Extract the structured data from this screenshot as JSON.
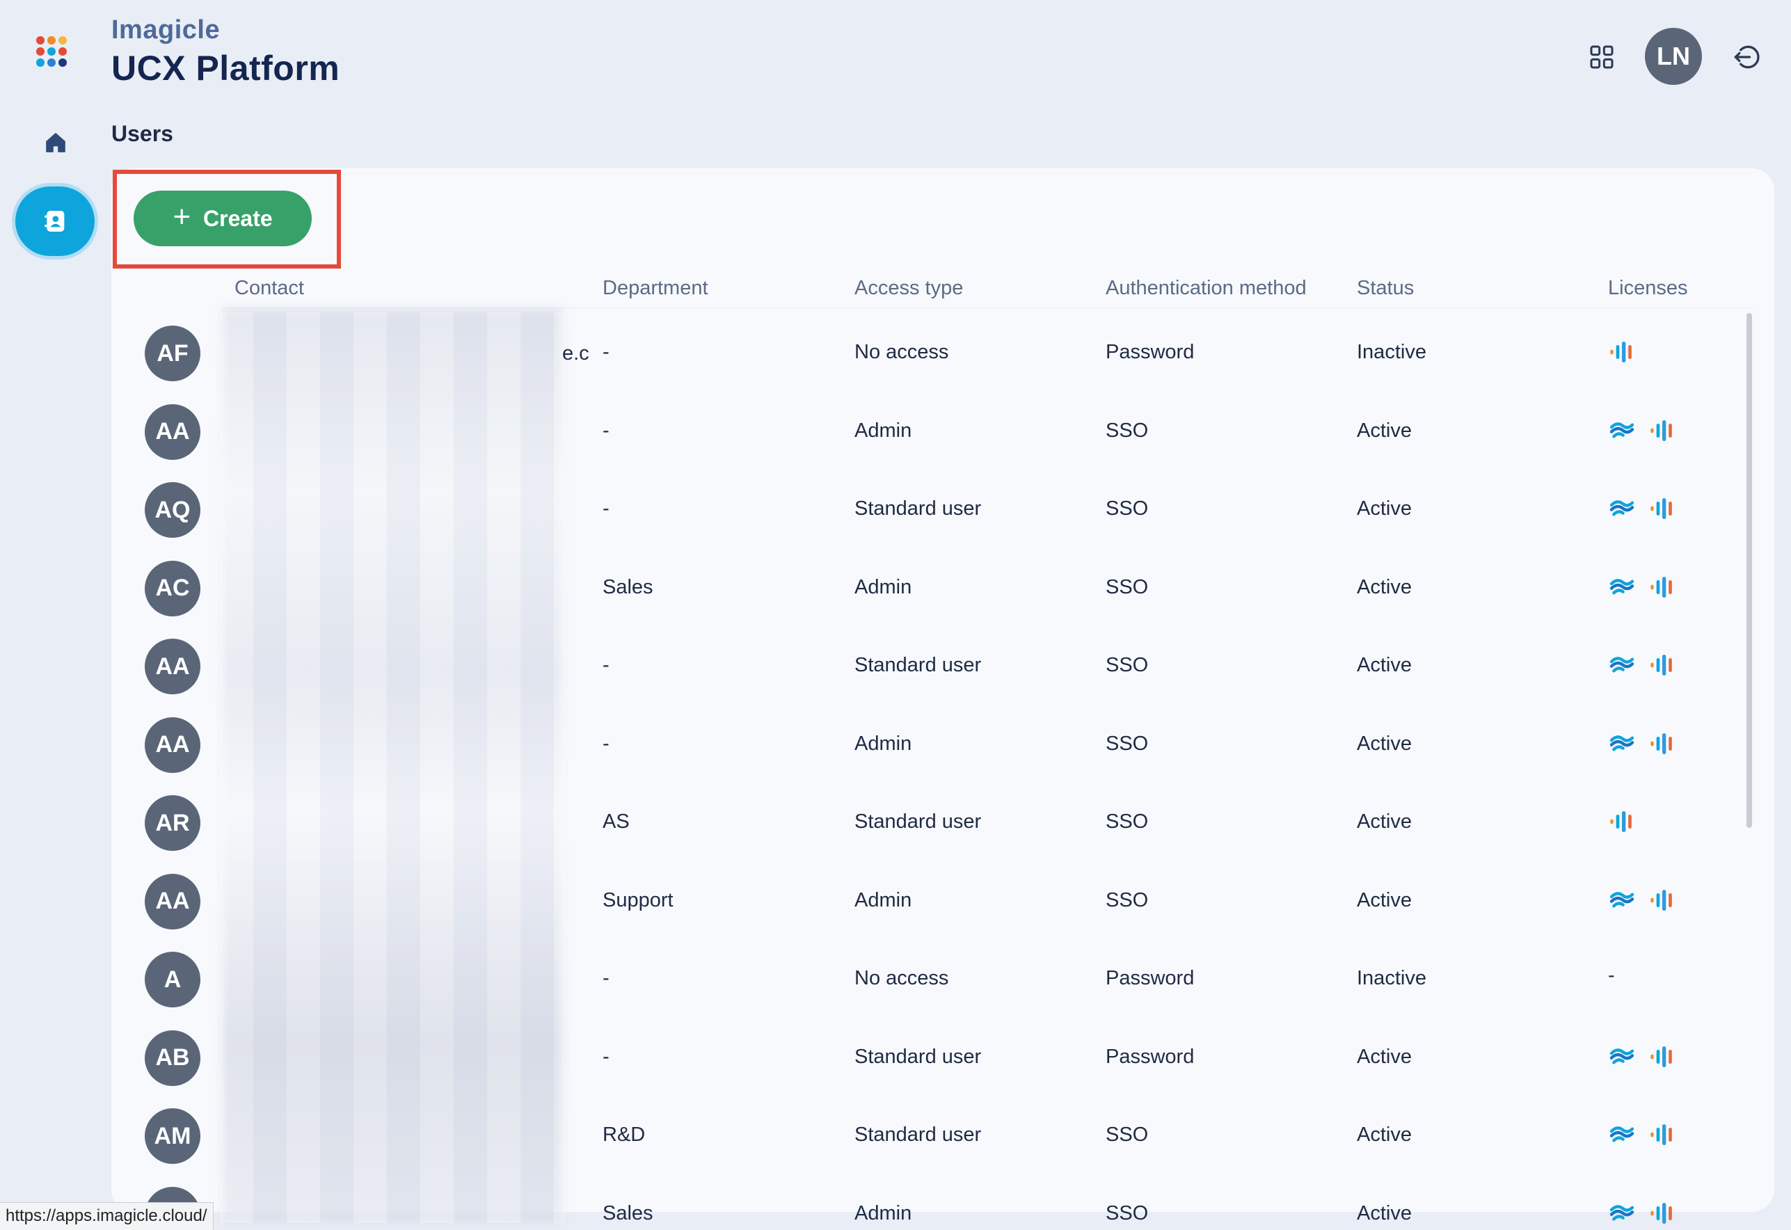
{
  "brand": {
    "company": "Imagicle",
    "product": "UCX Platform"
  },
  "breadcrumb": "Users",
  "user_avatar": "LN",
  "create_button": {
    "label": "Create"
  },
  "columns": {
    "contact": "Contact",
    "department": "Department",
    "access": "Access type",
    "auth": "Authentication method",
    "status": "Status",
    "licenses": "Licenses"
  },
  "contact_fragment": "e.c",
  "rows": [
    {
      "initials": "AF",
      "department": "-",
      "access": "No access",
      "auth": "Password",
      "status": "Inactive",
      "licenses": [
        "bars"
      ]
    },
    {
      "initials": "AA",
      "department": "-",
      "access": "Admin",
      "auth": "SSO",
      "status": "Active",
      "licenses": [
        "wave",
        "bars"
      ]
    },
    {
      "initials": "AQ",
      "department": "-",
      "access": "Standard user",
      "auth": "SSO",
      "status": "Active",
      "licenses": [
        "wave",
        "bars"
      ]
    },
    {
      "initials": "AC",
      "department": "Sales",
      "access": "Admin",
      "auth": "SSO",
      "status": "Active",
      "licenses": [
        "wave",
        "bars"
      ]
    },
    {
      "initials": "AA",
      "department": "-",
      "access": "Standard user",
      "auth": "SSO",
      "status": "Active",
      "licenses": [
        "wave",
        "bars"
      ]
    },
    {
      "initials": "AA",
      "department": "-",
      "access": "Admin",
      "auth": "SSO",
      "status": "Active",
      "licenses": [
        "wave",
        "bars"
      ]
    },
    {
      "initials": "AR",
      "department": "AS",
      "access": "Standard user",
      "auth": "SSO",
      "status": "Active",
      "licenses": [
        "bars"
      ]
    },
    {
      "initials": "AA",
      "department": "Support",
      "access": "Admin",
      "auth": "SSO",
      "status": "Active",
      "licenses": [
        "wave",
        "bars"
      ]
    },
    {
      "initials": "A",
      "department": "-",
      "access": "No access",
      "auth": "Password",
      "status": "Inactive",
      "licenses": []
    },
    {
      "initials": "AB",
      "department": "-",
      "access": "Standard user",
      "auth": "Password",
      "status": "Active",
      "licenses": [
        "wave",
        "bars"
      ]
    },
    {
      "initials": "AM",
      "department": "R&D",
      "access": "Standard user",
      "auth": "SSO",
      "status": "Active",
      "licenses": [
        "wave",
        "bars"
      ]
    },
    {
      "initials": "",
      "department": "Sales",
      "access": "Admin",
      "auth": "SSO",
      "status": "Active",
      "licenses": [
        "wave",
        "bars"
      ]
    }
  ],
  "empty_license": "-",
  "status_bar_url": "https://apps.imagicle.cloud/",
  "colors": {
    "primary": "#0ea5dc",
    "create": "#38a169",
    "highlight": "#e5493a",
    "avatar": "#5a6678"
  },
  "icons": {
    "logo": "imagicle-dots-logo",
    "home": "home-icon",
    "users": "contact-book-icon",
    "apps": "grid-icon",
    "logout": "logout-icon",
    "license_wave": "wave-license-icon",
    "license_bars": "audio-bars-license-icon"
  }
}
